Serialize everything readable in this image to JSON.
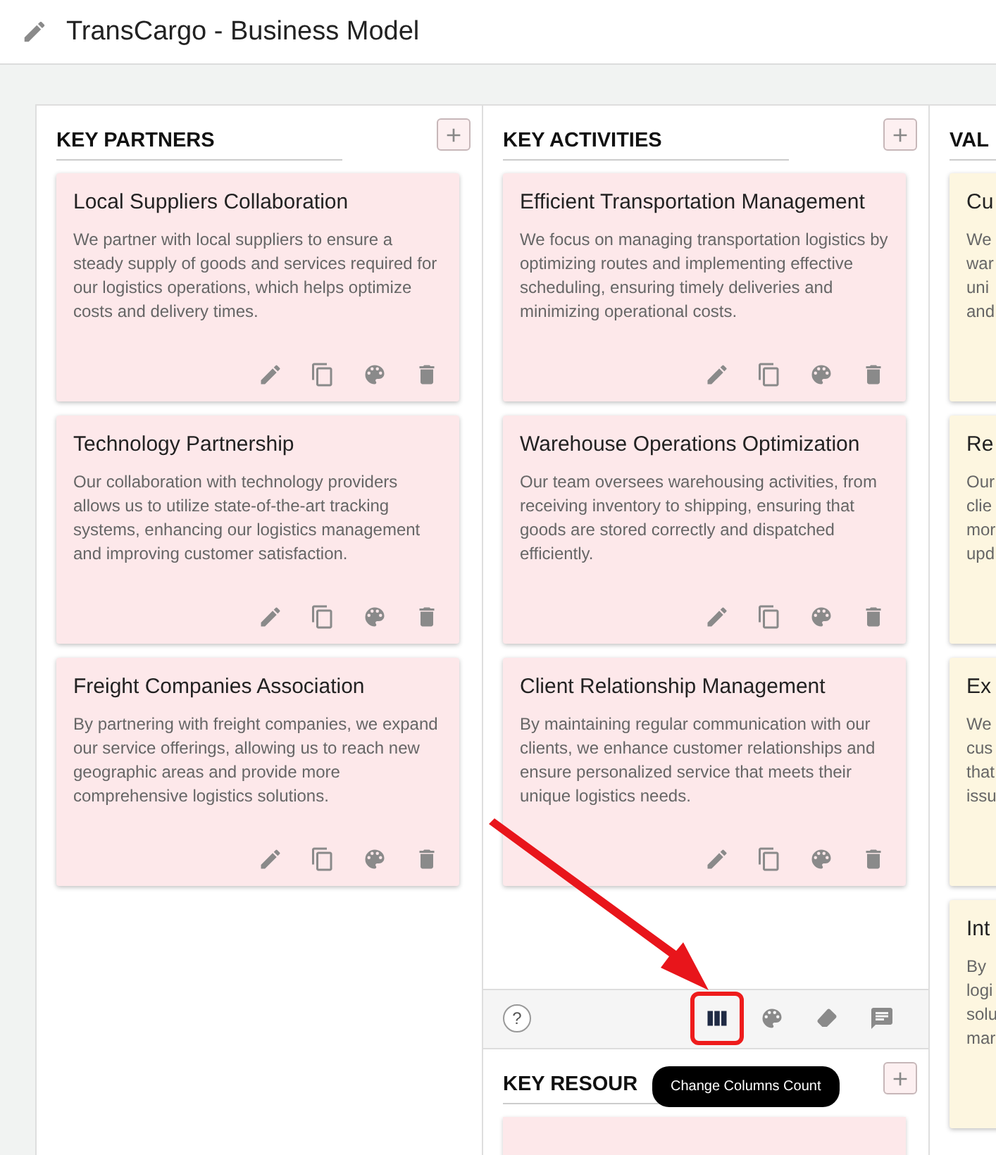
{
  "header": {
    "title": "TransCargo - Business Model"
  },
  "pointer_arrow": true,
  "columns": [
    {
      "title": "KEY PARTNERS",
      "color": "#fde8ea",
      "cards": [
        {
          "title": "Local Suppliers Collaboration",
          "body": "We partner with local suppliers to ensure a steady supply of goods and services required for our logistics operations, which helps optimize costs and delivery times."
        },
        {
          "title": "Technology Partnership",
          "body": "Our collaboration with technology providers allows us to utilize state-of-the-art tracking systems, enhancing our logistics management and improving customer satisfaction."
        },
        {
          "title": "Freight Companies Association",
          "body": "By partnering with freight companies, we expand our service offerings, allowing us to reach new geographic areas and provide more comprehensive logistics solutions."
        }
      ]
    },
    {
      "title": "KEY ACTIVITIES",
      "color": "#fde8ea",
      "cards": [
        {
          "title": "Efficient Transportation Management",
          "body": "We focus on managing transportation logistics by optimizing routes and implementing effective scheduling, ensuring timely deliveries and minimizing operational costs."
        },
        {
          "title": "Warehouse Operations Optimization",
          "body": "Our team oversees warehousing activities, from receiving inventory to shipping, ensuring that goods are stored correctly and dispatched efficiently."
        },
        {
          "title": "Client Relationship Management",
          "body": "By maintaining regular communication with our clients, we enhance customer relationships and ensure personalized service that meets their unique logistics needs."
        }
      ],
      "toolbar": {
        "help": "?",
        "tools": [
          {
            "kind": "columns",
            "highlighted": true
          },
          {
            "kind": "palette",
            "highlighted": false
          },
          {
            "kind": "eraser",
            "highlighted": false
          },
          {
            "kind": "comment",
            "highlighted": false
          }
        ],
        "tooltip": "Change Columns Count"
      },
      "next_section": {
        "title": "KEY RESOUR",
        "color": "#fde8ea"
      }
    },
    {
      "title": "VAL",
      "color": "#fdf6e0",
      "cards": [
        {
          "title": "Cu",
          "lines": [
            "We",
            "war",
            "uni",
            "and"
          ]
        },
        {
          "title": "Re",
          "lines": [
            "Our",
            "clie",
            "mor",
            "upd"
          ]
        },
        {
          "title": "Ex",
          "lines": [
            "We",
            "cus",
            "that",
            "issu"
          ]
        },
        {
          "title": "Int",
          "lines": [
            "By",
            "logi",
            "solu",
            "mar"
          ]
        }
      ]
    }
  ]
}
